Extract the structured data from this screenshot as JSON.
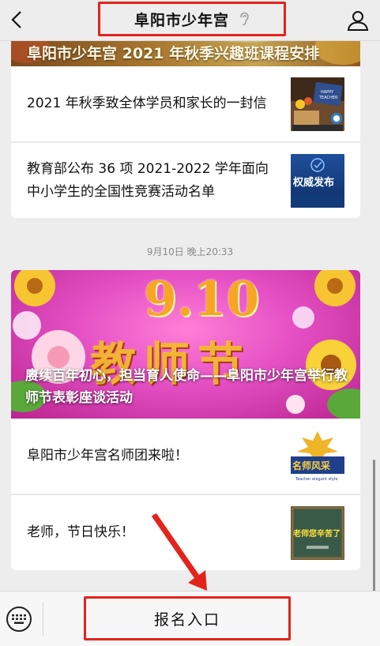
{
  "nav": {
    "title": "阜阳市少年宫",
    "back_icon": "chevron-left-icon",
    "listen_icon": "ear-icon",
    "profile_icon": "user-icon"
  },
  "articles_group_1": {
    "banner_text": "阜阳市少年宫 2021 年秋季兴趣班课程安排",
    "items": [
      {
        "title": "2021 年秋季致全体学员和家长的一封信",
        "thumb_text": ""
      },
      {
        "title": "教育部公布 36 项 2021-2022 学年面向中小学生的全国性竞赛活动名单",
        "thumb_text": "权威发布"
      }
    ]
  },
  "timestamp": "9月10日 晚上20:33",
  "articles_group_2": {
    "hero_date": "9.10",
    "hero_festival": "教师节",
    "hero_title": "赓续百年初心，担当育人使命——阜阳市少年宫举行教师节表彰座谈活动",
    "items": [
      {
        "title": "阜阳市少年宫名师团来啦！",
        "thumb_text": "名师风采",
        "thumb_subtext": "Teacher elegant style"
      },
      {
        "title": "老师，节日快乐！",
        "thumb_text": "老师您辛苦了",
        "thumb_subtext": ""
      }
    ]
  },
  "bottom_bar": {
    "keyboard_icon": "keyboard-icon",
    "menu_label": "报名入口"
  },
  "colors": {
    "highlight": "#e3241b",
    "background": "#ededed"
  }
}
